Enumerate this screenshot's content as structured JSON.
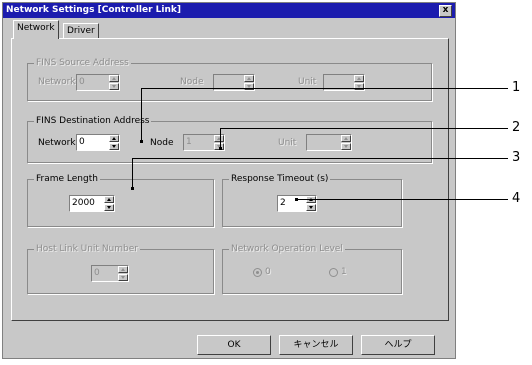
{
  "dialog": {
    "title": "Network Settings [Controller Link]",
    "close_label": "x"
  },
  "tabs": [
    {
      "label": "Network",
      "active": true
    },
    {
      "label": "Driver",
      "active": false
    }
  ],
  "groups": {
    "fins_source": {
      "legend": "FINS Source Address",
      "network_label": "Network",
      "network_value": "0",
      "node_label": "Node",
      "node_value": "",
      "unit_label": "Unit",
      "unit_value": ""
    },
    "fins_destination": {
      "legend": "FINS Destination Address",
      "network_label": "Network",
      "network_value": "0",
      "node_label": "Node",
      "node_value": "1",
      "unit_label": "Unit",
      "unit_value": ""
    },
    "frame_length": {
      "legend": "Frame Length",
      "value": "2000"
    },
    "response_timeout": {
      "legend": "Response Timeout (s)",
      "value": "2"
    },
    "host_link_unit": {
      "legend": "Host Link Unit Number",
      "value": "0"
    },
    "network_operation_level": {
      "legend": "Network Operation Level",
      "option0": "0",
      "option1": "1",
      "selected": "0"
    }
  },
  "buttons": {
    "ok": "OK",
    "cancel": "キャンセル",
    "help": "ヘルプ"
  },
  "callouts": [
    "1",
    "2",
    "3",
    "4"
  ]
}
